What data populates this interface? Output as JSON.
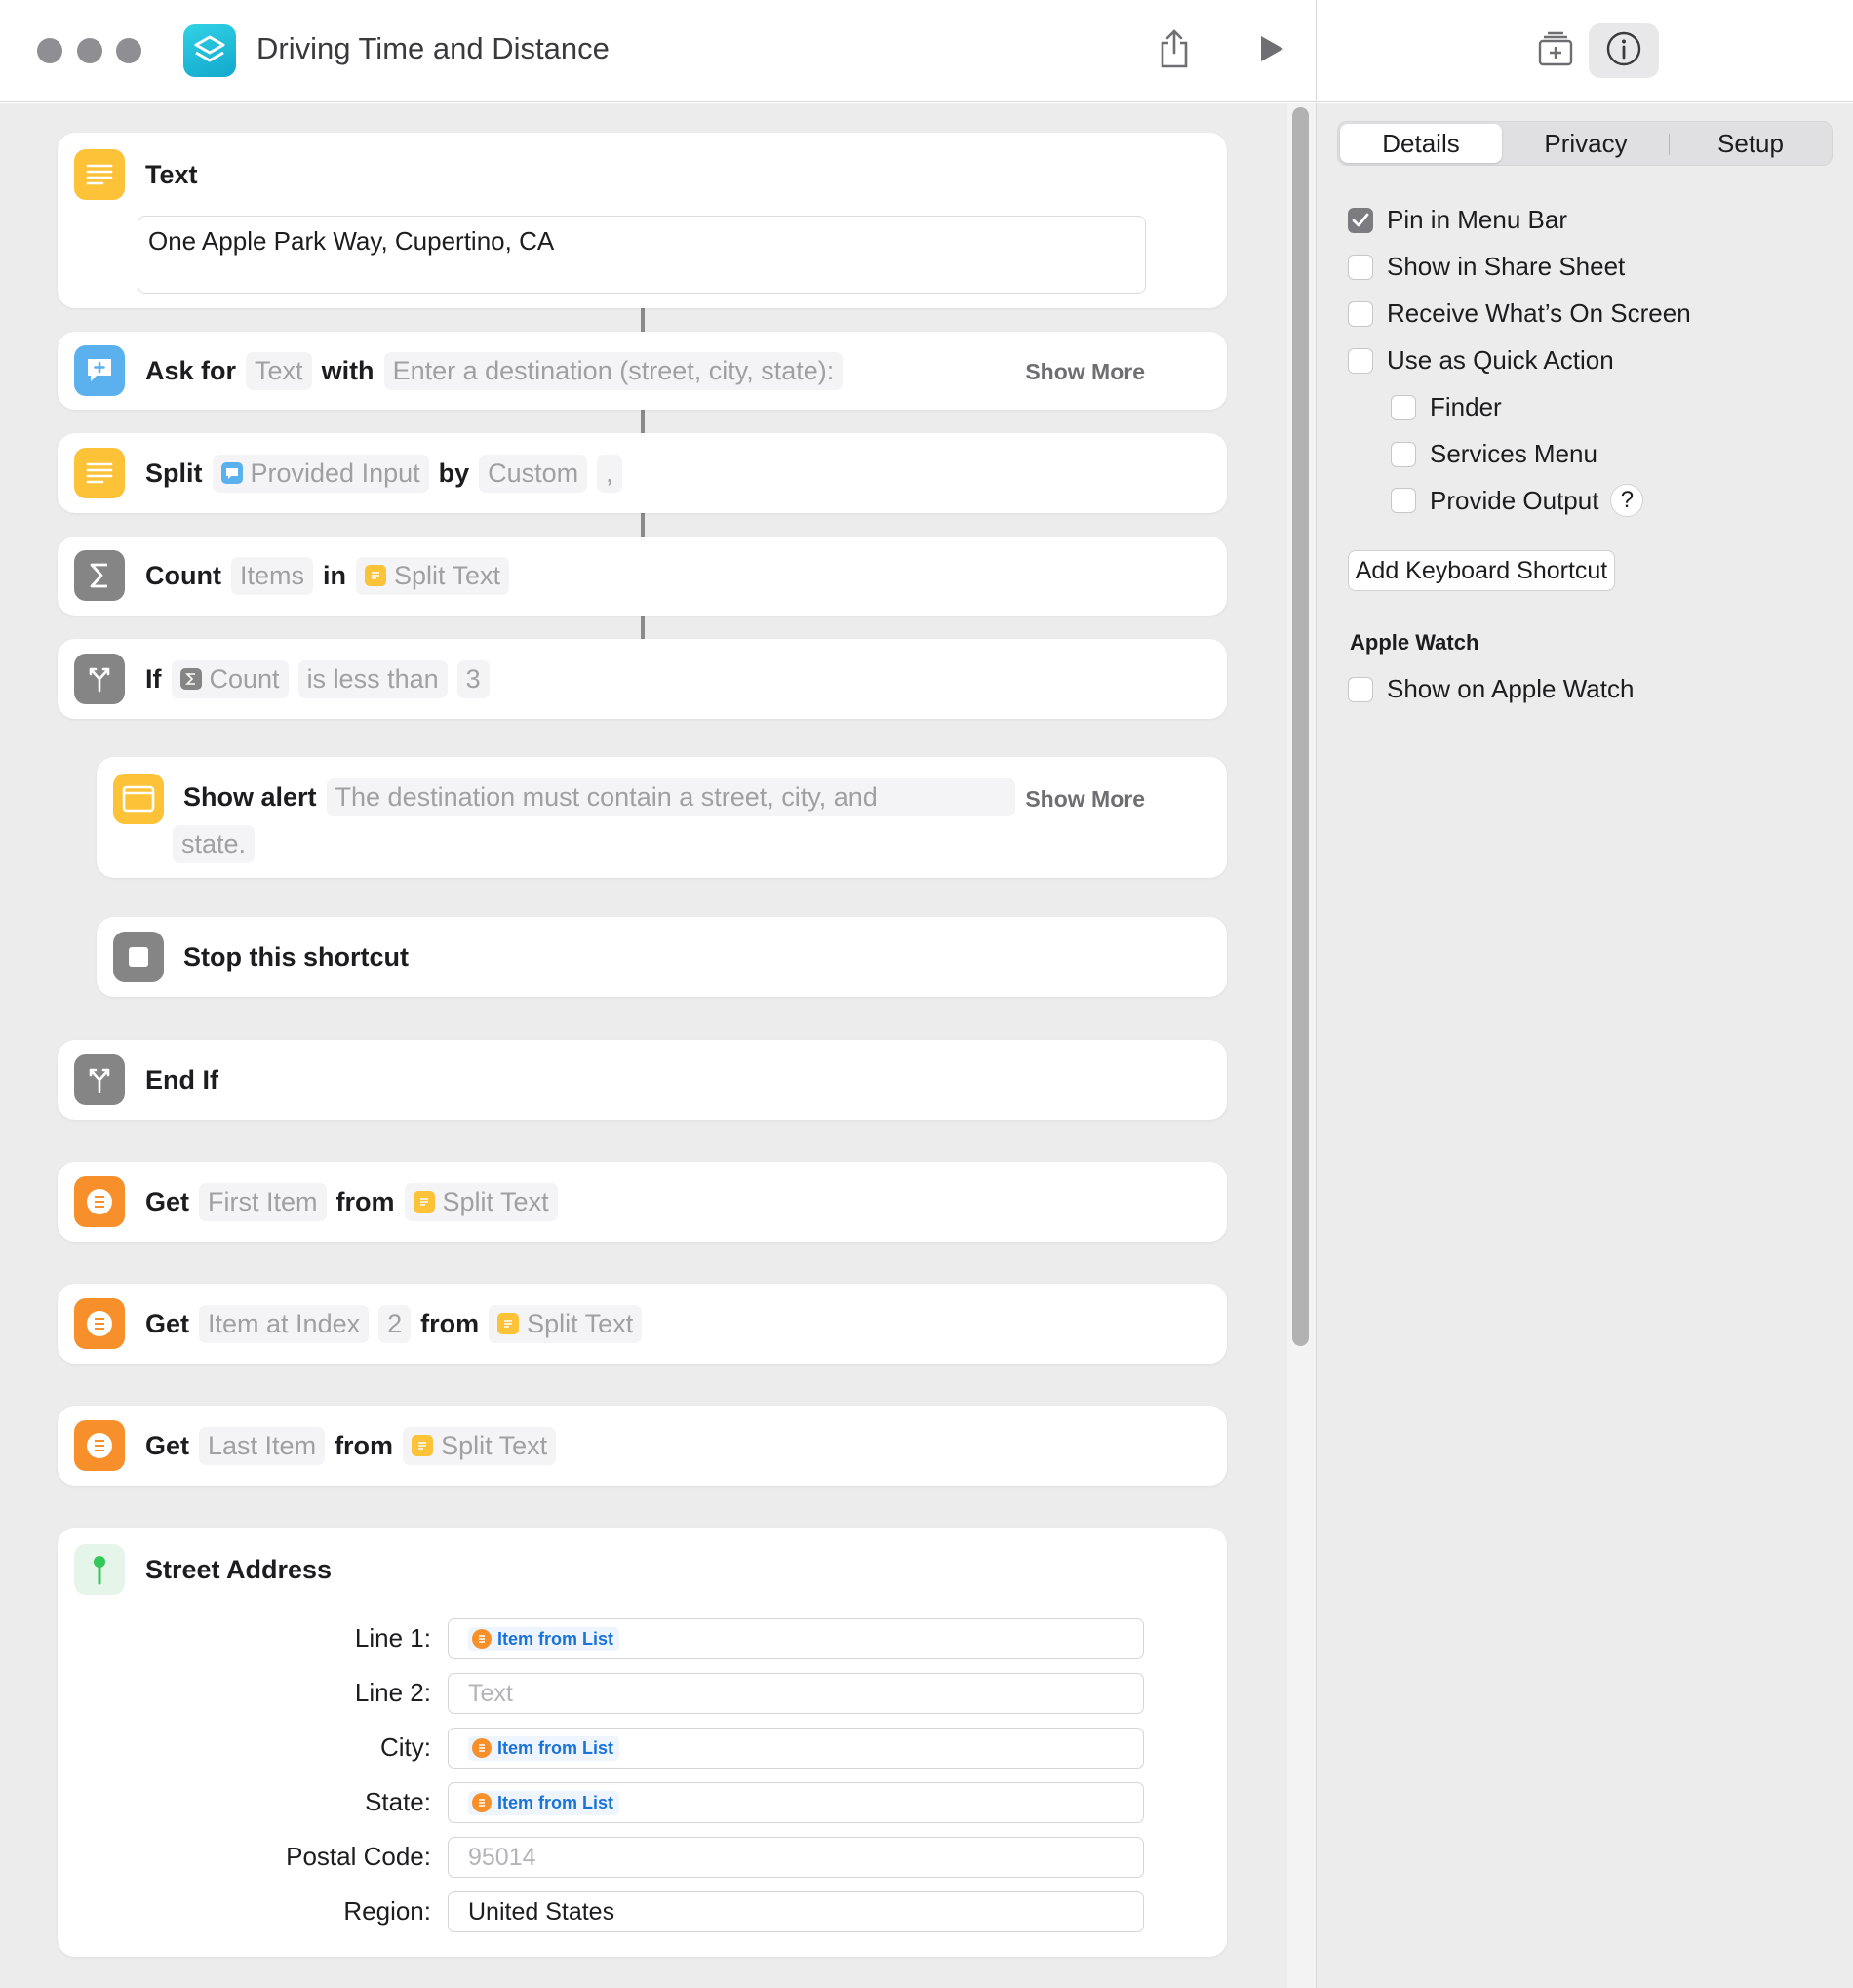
{
  "window": {
    "title": "Driving Time and Distance"
  },
  "actions": {
    "text": {
      "name": "Text",
      "value": "One Apple Park Way, Cupertino, CA"
    },
    "ask": {
      "kw1": "Ask for",
      "type": "Text",
      "kw2": "with",
      "prompt": "Enter a destination (street, city, state):",
      "show_more": "Show More"
    },
    "split": {
      "kw1": "Split",
      "input": "Provided Input",
      "kw2": "by",
      "mode": "Custom",
      "sep": ","
    },
    "count": {
      "kw1": "Count",
      "what": "Items",
      "kw2": "in",
      "source": "Split Text"
    },
    "if": {
      "kw": "If",
      "var": "Count",
      "cond": "is less than",
      "value": "3"
    },
    "alert": {
      "kw": "Show alert",
      "msg1": "The destination must contain a street, city, and",
      "msg2": "state.",
      "show_more": "Show More"
    },
    "stop": {
      "label": "Stop this shortcut"
    },
    "endif": {
      "label": "End If"
    },
    "get1": {
      "kw1": "Get",
      "which": "First Item",
      "kw2": "from",
      "source": "Split Text"
    },
    "get2": {
      "kw1": "Get",
      "which": "Item at Index",
      "index": "2",
      "kw2": "from",
      "source": "Split Text"
    },
    "get3": {
      "kw1": "Get",
      "which": "Last Item",
      "kw2": "from",
      "source": "Split Text"
    },
    "address": {
      "title": "Street Address",
      "fields": [
        {
          "label": "Line 1:",
          "value": "Item from List"
        },
        {
          "label": "Line 2:",
          "placeholder": "Text"
        },
        {
          "label": "City:",
          "value": "Item from List"
        },
        {
          "label": "State:",
          "value": "Item from List"
        },
        {
          "label": "Postal Code:",
          "placeholder": "95014"
        },
        {
          "label": "Region:",
          "value": "United States"
        }
      ]
    }
  },
  "inspector": {
    "tabs": [
      "Details",
      "Privacy",
      "Setup"
    ],
    "active_tab": "Details",
    "options": [
      {
        "label": "Pin in Menu Bar",
        "checked": true
      },
      {
        "label": "Show in Share Sheet",
        "checked": false
      },
      {
        "label": "Receive What’s On Screen",
        "checked": false
      },
      {
        "label": "Use as Quick Action",
        "checked": false
      },
      {
        "label": "Finder",
        "checked": false
      },
      {
        "label": "Services Menu",
        "checked": false
      },
      {
        "label": "Provide Output",
        "checked": false
      }
    ],
    "help_glyph": "?",
    "shortcut_button": "Add Keyboard Shortcut",
    "watch_section": "Apple Watch",
    "watch_option": {
      "label": "Show on Apple Watch",
      "checked": false
    }
  },
  "colors": {
    "text_action": "#fcc339",
    "ask_action": "#5ab1ee",
    "script_action": "#858585",
    "list_action": "#f7902b",
    "location_action": "#34c759",
    "variable_pill_text": "#1a73d9"
  },
  "icons": [
    "shortcuts-app-icon",
    "share-icon",
    "play-icon",
    "add-to-library-icon",
    "info-icon",
    "text-lines-icon",
    "speech-bubble-plus-icon",
    "sigma-icon",
    "branch-icon",
    "alert-window-icon",
    "stop-square-icon",
    "list-icon",
    "map-pin-icon",
    "checkmark-icon"
  ]
}
